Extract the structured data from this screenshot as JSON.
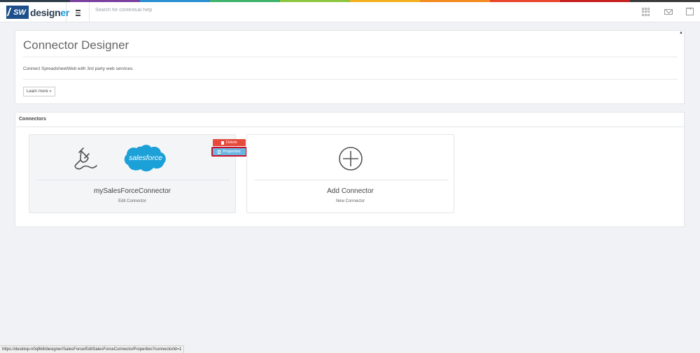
{
  "rainbow_colors": [
    "#2f3d4a",
    "#7b3fa0",
    "#2a8fd1",
    "#3db26b",
    "#8cc63f",
    "#f2b01e",
    "#f28a1d",
    "#e8452c",
    "#c81e1e",
    "#3a3a3a"
  ],
  "topbar": {
    "logo_badge": "SW",
    "logo_text_main": "design",
    "logo_text_accent": "er",
    "search_placeholder": "Search for contextual help",
    "icons": [
      "apps-grid-icon",
      "mail-icon",
      "exit-icon"
    ]
  },
  "intro": {
    "title": "Connector Designer",
    "description": "Connect SpreadsheetWeb with 3rd party web services.",
    "learn_more": "Learn more »",
    "close": "×"
  },
  "connectors": {
    "heading": "Connectors",
    "cards": [
      {
        "name": "mySalesForceConnector",
        "subtitle": "Edit Connector",
        "logo_text": "salesforce",
        "delete_label": "Delete",
        "properties_label": "Properties"
      },
      {
        "name": "Add Connector",
        "subtitle": "New Connector"
      }
    ]
  },
  "status_url": "https://desktop-n0q9k8/designer/SalesForce/EditSalesForceConnectorProperties?connectorId=1"
}
